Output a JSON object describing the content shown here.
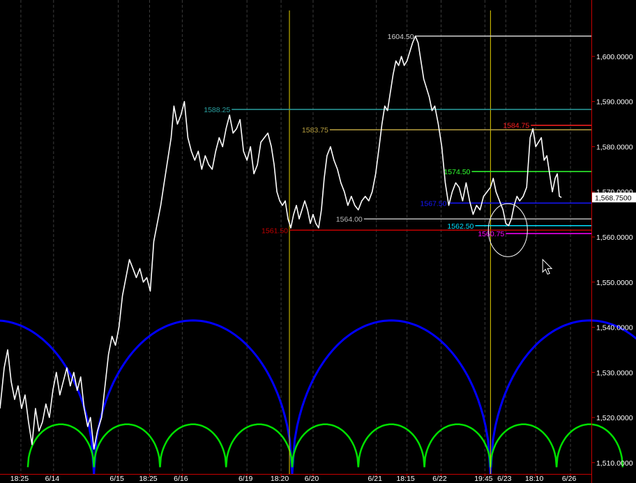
{
  "colors": {
    "background": "#000000",
    "price": "#ffffff",
    "axis": "#c80000",
    "grid": "#3a3a3a",
    "vline": "#e6d200",
    "cycle_large": "#0000ff",
    "cycle_small": "#00e000",
    "circle": "#ffffff",
    "cursor": "#ffffff"
  },
  "chart_data": {
    "type": "line",
    "title": "",
    "xlabel": "",
    "ylabel": "",
    "ylim": [
      1507.5,
      1612.5
    ],
    "y_ticks": [
      {
        "value": 1510,
        "label": "1,510.0000"
      },
      {
        "value": 1520,
        "label": "1,520.0000"
      },
      {
        "value": 1530,
        "label": "1,530.0000"
      },
      {
        "value": 1540,
        "label": "1,540.0000"
      },
      {
        "value": 1550,
        "label": "1,550.0000"
      },
      {
        "value": 1560,
        "label": "1,560.0000"
      },
      {
        "value": 1570,
        "label": "1,570.0000"
      },
      {
        "value": 1580,
        "label": "1,580.0000"
      },
      {
        "value": 1590,
        "label": "1,590.0000"
      },
      {
        "value": 1600,
        "label": "1,600.0000"
      }
    ],
    "last_price": {
      "value": 1568.75,
      "label": "1,568.7500"
    },
    "x_labels": [
      {
        "label": "18:25",
        "bar": 30
      },
      {
        "label": "6/14",
        "bar": 77
      },
      {
        "label": "6/15",
        "bar": 170
      },
      {
        "label": "18:25",
        "bar": 215
      },
      {
        "label": "6/16",
        "bar": 262
      },
      {
        "label": "6/19",
        "bar": 355
      },
      {
        "label": "18:20",
        "bar": 404
      },
      {
        "label": "6/20",
        "bar": 450
      },
      {
        "label": "6/21",
        "bar": 541
      },
      {
        "label": "18:15",
        "bar": 585
      },
      {
        "label": "6/22",
        "bar": 634
      },
      {
        "label": "19:45",
        "bar": 697
      },
      {
        "label": "6/23",
        "bar": 727
      },
      {
        "label": "18:10",
        "bar": 770
      },
      {
        "label": "6/26",
        "bar": 820
      }
    ],
    "x_range": [
      0,
      850
    ],
    "series": [
      {
        "points": [
          [
            0,
            1522
          ],
          [
            6,
            1531
          ],
          [
            11,
            1535
          ],
          [
            16,
            1528
          ],
          [
            21,
            1524
          ],
          [
            26,
            1527
          ],
          [
            31,
            1522
          ],
          [
            36,
            1525
          ],
          [
            41,
            1519
          ],
          [
            46,
            1514
          ],
          [
            51,
            1522
          ],
          [
            56,
            1517
          ],
          [
            61,
            1519
          ],
          [
            66,
            1523
          ],
          [
            71,
            1520
          ],
          [
            76,
            1526
          ],
          [
            81,
            1530
          ],
          [
            86,
            1525
          ],
          [
            91,
            1528
          ],
          [
            96,
            1531
          ],
          [
            101,
            1527
          ],
          [
            106,
            1530
          ],
          [
            111,
            1526
          ],
          [
            116,
            1529
          ],
          [
            121,
            1522
          ],
          [
            126,
            1518
          ],
          [
            130,
            1520
          ],
          [
            135,
            1513
          ],
          [
            140,
            1517
          ],
          [
            146,
            1520
          ],
          [
            151,
            1527
          ],
          [
            156,
            1534
          ],
          [
            161,
            1538
          ],
          [
            166,
            1536
          ],
          [
            171,
            1540
          ],
          [
            176,
            1547
          ],
          [
            181,
            1551
          ],
          [
            186,
            1555
          ],
          [
            191,
            1553
          ],
          [
            196,
            1551
          ],
          [
            201,
            1553
          ],
          [
            206,
            1550
          ],
          [
            211,
            1551
          ],
          [
            216,
            1548
          ],
          [
            221,
            1559
          ],
          [
            226,
            1563
          ],
          [
            231,
            1567
          ],
          [
            236,
            1572
          ],
          [
            241,
            1577
          ],
          [
            246,
            1582
          ],
          [
            250,
            1589
          ],
          [
            255,
            1585
          ],
          [
            260,
            1587
          ],
          [
            265,
            1590
          ],
          [
            270,
            1582
          ],
          [
            275,
            1579
          ],
          [
            280,
            1577
          ],
          [
            285,
            1579
          ],
          [
            290,
            1575
          ],
          [
            295,
            1578
          ],
          [
            300,
            1576
          ],
          [
            305,
            1575
          ],
          [
            310,
            1579
          ],
          [
            315,
            1582
          ],
          [
            320,
            1580
          ],
          [
            325,
            1584
          ],
          [
            330,
            1587
          ],
          [
            335,
            1583
          ],
          [
            340,
            1584
          ],
          [
            345,
            1586
          ],
          [
            350,
            1579
          ],
          [
            355,
            1577
          ],
          [
            360,
            1580
          ],
          [
            365,
            1574
          ],
          [
            370,
            1576
          ],
          [
            375,
            1581
          ],
          [
            380,
            1582
          ],
          [
            385,
            1583
          ],
          [
            390,
            1580
          ],
          [
            394,
            1576
          ],
          [
            398,
            1570
          ],
          [
            402,
            1568
          ],
          [
            406,
            1567
          ],
          [
            410,
            1568
          ],
          [
            414,
            1564
          ],
          [
            418,
            1562
          ],
          [
            422,
            1565
          ],
          [
            426,
            1567
          ],
          [
            430,
            1564
          ],
          [
            434,
            1566
          ],
          [
            438,
            1568
          ],
          [
            442,
            1566
          ],
          [
            446,
            1563
          ],
          [
            450,
            1565
          ],
          [
            454,
            1563
          ],
          [
            458,
            1562
          ],
          [
            462,
            1566
          ],
          [
            466,
            1573
          ],
          [
            470,
            1578
          ],
          [
            475,
            1580
          ],
          [
            480,
            1577
          ],
          [
            485,
            1575
          ],
          [
            490,
            1572
          ],
          [
            495,
            1570
          ],
          [
            500,
            1567
          ],
          [
            505,
            1569
          ],
          [
            510,
            1567
          ],
          [
            515,
            1566
          ],
          [
            520,
            1568
          ],
          [
            525,
            1569
          ],
          [
            530,
            1568
          ],
          [
            535,
            1570
          ],
          [
            540,
            1574
          ],
          [
            545,
            1580
          ],
          [
            549,
            1585
          ],
          [
            553,
            1589
          ],
          [
            557,
            1588
          ],
          [
            561,
            1592
          ],
          [
            565,
            1596
          ],
          [
            569,
            1599
          ],
          [
            573,
            1598
          ],
          [
            577,
            1600
          ],
          [
            581,
            1598
          ],
          [
            585,
            1599
          ],
          [
            589,
            1601
          ],
          [
            593,
            1603
          ],
          [
            597,
            1604.5
          ],
          [
            601,
            1603
          ],
          [
            605,
            1599
          ],
          [
            609,
            1595
          ],
          [
            613,
            1593
          ],
          [
            617,
            1591
          ],
          [
            621,
            1588
          ],
          [
            625,
            1589
          ],
          [
            630,
            1585
          ],
          [
            635,
            1580
          ],
          [
            640,
            1572
          ],
          [
            645,
            1567
          ],
          [
            650,
            1570
          ],
          [
            655,
            1572
          ],
          [
            660,
            1571
          ],
          [
            665,
            1568
          ],
          [
            670,
            1572
          ],
          [
            675,
            1568
          ],
          [
            680,
            1565
          ],
          [
            685,
            1567
          ],
          [
            690,
            1566
          ],
          [
            695,
            1569
          ],
          [
            700,
            1570
          ],
          [
            705,
            1571
          ],
          [
            709,
            1573
          ],
          [
            713,
            1570
          ],
          [
            718,
            1568
          ],
          [
            723,
            1566
          ],
          [
            727,
            1563
          ],
          [
            731,
            1562.5
          ],
          [
            735,
            1564
          ],
          [
            739,
            1567
          ],
          [
            743,
            1569
          ],
          [
            747,
            1568
          ],
          [
            752,
            1569
          ],
          [
            757,
            1571
          ],
          [
            762,
            1582
          ],
          [
            766,
            1584
          ],
          [
            770,
            1580
          ],
          [
            774,
            1581
          ],
          [
            778,
            1582
          ],
          [
            782,
            1577
          ],
          [
            786,
            1578
          ],
          [
            790,
            1574
          ],
          [
            794,
            1570
          ],
          [
            798,
            1573
          ],
          [
            801,
            1574
          ],
          [
            804,
            1569
          ],
          [
            807,
            1568.75
          ]
        ]
      }
    ],
    "horizontal_lines": [
      {
        "label": "1604.50",
        "value": 1604.5,
        "color": "#d0d0d0",
        "bar": 597
      },
      {
        "label": "1588.25",
        "value": 1588.25,
        "color": "#2aa0a0",
        "bar": 333
      },
      {
        "label": "1583.75",
        "value": 1583.75,
        "color": "#b8a040",
        "bar": 474
      },
      {
        "label": "1584.75",
        "value": 1584.75,
        "color": "#ff2020",
        "bar": 763
      },
      {
        "label": "1574.50",
        "value": 1574.5,
        "color": "#30ff30",
        "bar": 678
      },
      {
        "label": "1567.50",
        "value": 1567.5,
        "color": "#1515ff",
        "bar": 644
      },
      {
        "label": "1564.00",
        "value": 1564.0,
        "color": "#b8b8b8",
        "bar": 523
      },
      {
        "label": "1562.50",
        "value": 1562.5,
        "color": "#00e0ff",
        "bar": 683
      },
      {
        "label": "1561.50",
        "value": 1561.5,
        "color": "#c00000",
        "bar": 416
      },
      {
        "label": "1560.75",
        "value": 1560.75,
        "color": "#ff00ff",
        "bar": 727
      }
    ],
    "vertical_lines": [
      416,
      705
    ],
    "cycles": [
      {
        "name": "",
        "kind": "large",
        "troughs": [
          -148,
          135,
          420,
          705,
          990
        ],
        "peak": 1541.5,
        "base": 1507.5
      },
      {
        "name": "",
        "kind": "small",
        "troughs": [
          40,
          135,
          230,
          325,
          420,
          515,
          610,
          705,
          800,
          895
        ],
        "peak": 1518.5,
        "base": 1509
      }
    ],
    "highlight_circle": {
      "bar": 730,
      "value": 1561.5
    },
    "cursor": {
      "bar": 780,
      "value": 1555
    }
  }
}
